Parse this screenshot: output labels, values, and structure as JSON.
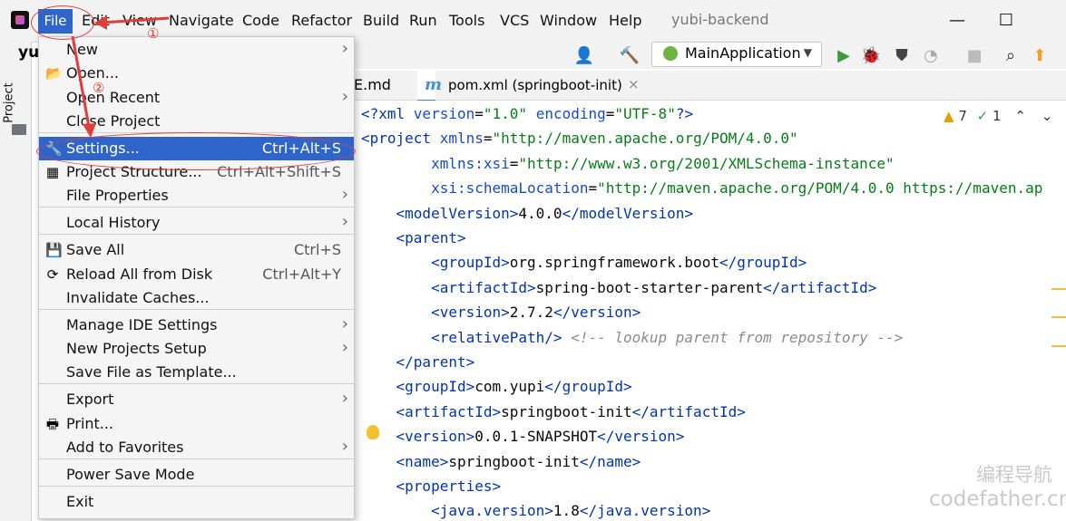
{
  "menubar": {
    "items": [
      "File",
      "Edit",
      "View",
      "Navigate",
      "Code",
      "Refactor",
      "Build",
      "Run",
      "Tools",
      "VCS",
      "Window",
      "Help"
    ],
    "window_title": "yubi-backend",
    "minimize": "—",
    "maximize": "☐"
  },
  "left": {
    "project_tab": "Project",
    "root_label": "yu"
  },
  "toolbar": {
    "run_config": "MainApplication"
  },
  "tabs": {
    "readme": "E.md",
    "pom_icon": "m",
    "pom": "pom.xml (springboot-init)",
    "close": "×"
  },
  "inspections": {
    "warnings": "7",
    "weak": "1"
  },
  "file_menu": {
    "items": [
      {
        "label": "New",
        "shortcut": "",
        "submenu": true
      },
      {
        "label": "Open...",
        "shortcut": "",
        "submenu": false
      },
      {
        "label": "Open Recent",
        "shortcut": "",
        "submenu": true
      },
      {
        "label": "Close Project",
        "shortcut": "",
        "submenu": false
      },
      {
        "label": "Settings...",
        "shortcut": "Ctrl+Alt+S",
        "submenu": false
      },
      {
        "label": "Project Structure...",
        "shortcut": "Ctrl+Alt+Shift+S",
        "submenu": false
      },
      {
        "label": "File Properties",
        "shortcut": "",
        "submenu": true
      },
      {
        "label": "Local History",
        "shortcut": "",
        "submenu": true
      },
      {
        "label": "Save All",
        "shortcut": "Ctrl+S",
        "submenu": false
      },
      {
        "label": "Reload All from Disk",
        "shortcut": "Ctrl+Alt+Y",
        "submenu": false
      },
      {
        "label": "Invalidate Caches...",
        "shortcut": "",
        "submenu": false
      },
      {
        "label": "Manage IDE Settings",
        "shortcut": "",
        "submenu": true
      },
      {
        "label": "New Projects Setup",
        "shortcut": "",
        "submenu": true
      },
      {
        "label": "Save File as Template...",
        "shortcut": "",
        "submenu": false
      },
      {
        "label": "Export",
        "shortcut": "",
        "submenu": true
      },
      {
        "label": "Print...",
        "shortcut": "",
        "submenu": false
      },
      {
        "label": "Add to Favorites",
        "shortcut": "",
        "submenu": true
      },
      {
        "label": "Power Save Mode",
        "shortcut": "",
        "submenu": false
      },
      {
        "label": "Exit",
        "shortcut": "",
        "submenu": false
      }
    ],
    "submenu_glyph": "›"
  },
  "annotations": {
    "step1": "①",
    "step2": "②"
  },
  "code": [
    [
      [
        "tag",
        "<?xml "
      ],
      [
        "attr",
        "version"
      ],
      [
        "txt",
        "="
      ],
      [
        "str",
        "\"1.0\""
      ],
      [
        "txt",
        " "
      ],
      [
        "attr",
        "encoding"
      ],
      [
        "txt",
        "="
      ],
      [
        "str",
        "\"UTF-8\""
      ],
      [
        "tag",
        "?>"
      ]
    ],
    [
      [
        "tag",
        "<project "
      ],
      [
        "attr",
        "xmlns"
      ],
      [
        "txt",
        "="
      ],
      [
        "str",
        "\"http://maven.apache.org/POM/4.0.0\""
      ]
    ],
    [
      [
        "txt",
        "        "
      ],
      [
        "attr",
        "xmlns:xsi"
      ],
      [
        "txt",
        "="
      ],
      [
        "str",
        "\"http://www.w3.org/2001/XMLSchema-instance\""
      ]
    ],
    [
      [
        "txt",
        "        "
      ],
      [
        "attr",
        "xsi:schemaLocation"
      ],
      [
        "txt",
        "="
      ],
      [
        "str",
        "\"http://maven.apache.org/POM/4.0.0 https://maven.ap"
      ]
    ],
    [
      [
        "txt",
        "    "
      ],
      [
        "tag",
        "<modelVersion>"
      ],
      [
        "txt",
        "4.0.0"
      ],
      [
        "tag",
        "</modelVersion>"
      ]
    ],
    [
      [
        "txt",
        "    "
      ],
      [
        "tag",
        "<parent>"
      ]
    ],
    [
      [
        "txt",
        "        "
      ],
      [
        "tag",
        "<groupId>"
      ],
      [
        "txt",
        "org.springframework.boot"
      ],
      [
        "tag",
        "</groupId>"
      ]
    ],
    [
      [
        "txt",
        "        "
      ],
      [
        "tag",
        "<artifactId>"
      ],
      [
        "txt",
        "spring-boot-starter-parent"
      ],
      [
        "tag",
        "</artifactId>"
      ]
    ],
    [
      [
        "txt",
        "        "
      ],
      [
        "tag",
        "<version>"
      ],
      [
        "txt",
        "2.7.2"
      ],
      [
        "tag",
        "</version>"
      ]
    ],
    [
      [
        "txt",
        "        "
      ],
      [
        "tag",
        "<relativePath/>"
      ],
      [
        "txt",
        " "
      ],
      [
        "comment",
        "<!-- lookup parent from repository -->"
      ]
    ],
    [
      [
        "txt",
        "    "
      ],
      [
        "tag",
        "</parent>"
      ]
    ],
    [
      [
        "txt",
        "    "
      ],
      [
        "tag",
        "<groupId>"
      ],
      [
        "txt",
        "com.yupi"
      ],
      [
        "tag",
        "</groupId>"
      ]
    ],
    [
      [
        "txt",
        "    "
      ],
      [
        "tag",
        "<artifactId>"
      ],
      [
        "txt",
        "springboot-init"
      ],
      [
        "tag",
        "</artifactId>"
      ]
    ],
    [
      [
        "txt",
        "    "
      ],
      [
        "tag",
        "<version>"
      ],
      [
        "txt",
        "0.0.1-SNAPSHOT"
      ],
      [
        "tag",
        "</version>"
      ]
    ],
    [
      [
        "txt",
        "    "
      ],
      [
        "tag",
        "<name>"
      ],
      [
        "txt",
        "springboot-init"
      ],
      [
        "tag",
        "</name>"
      ]
    ],
    [
      [
        "txt",
        "    "
      ],
      [
        "tag",
        "<properties>"
      ]
    ],
    [
      [
        "txt",
        "        "
      ],
      [
        "tag",
        "<java.version>"
      ],
      [
        "txt",
        "1.8"
      ],
      [
        "tag",
        "</java.version>"
      ]
    ]
  ],
  "watermark": {
    "line1": "编程导航",
    "line2": "codefather.cn"
  },
  "colors": {
    "accent": "#2f65ca",
    "annotation": "#e03c3c"
  }
}
